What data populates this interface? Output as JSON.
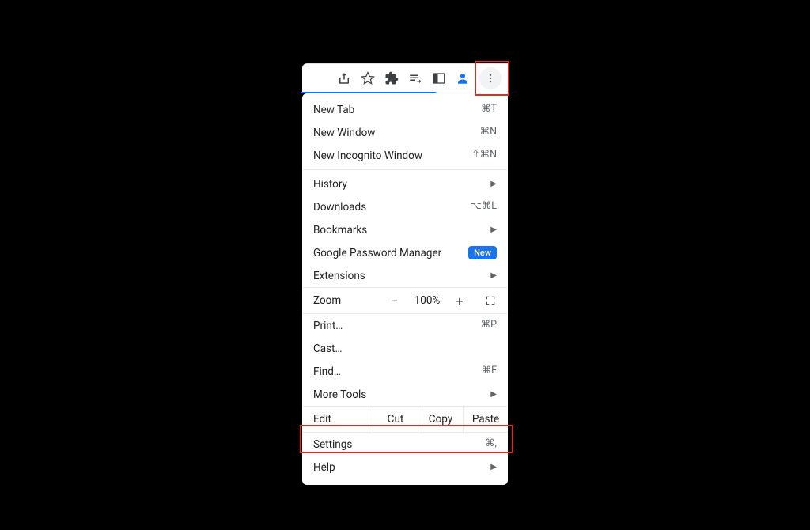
{
  "toolbar_icons": [
    "share",
    "star",
    "puzzle",
    "playlist",
    "panel",
    "profile",
    "kebab"
  ],
  "menu": {
    "group1": [
      {
        "label": "New Tab",
        "shortcut": "⌘T"
      },
      {
        "label": "New Window",
        "shortcut": "⌘N"
      },
      {
        "label": "New Incognito Window",
        "shortcut": "⇧⌘N"
      }
    ],
    "group2": [
      {
        "label": "History",
        "submenu": true
      },
      {
        "label": "Downloads",
        "shortcut": "⌥⌘L"
      },
      {
        "label": "Bookmarks",
        "submenu": true
      },
      {
        "label": "Google Password Manager",
        "badge": "New"
      },
      {
        "label": "Extensions",
        "submenu": true
      }
    ],
    "zoom": {
      "label": "Zoom",
      "value": "100%",
      "minus": "−",
      "plus": "+"
    },
    "group3": [
      {
        "label": "Print…",
        "shortcut": "⌘P"
      },
      {
        "label": "Cast…"
      },
      {
        "label": "Find…",
        "shortcut": "⌘F"
      },
      {
        "label": "More Tools",
        "submenu": true
      }
    ],
    "edit": {
      "label": "Edit",
      "cut": "Cut",
      "copy": "Copy",
      "paste": "Paste"
    },
    "group4": [
      {
        "label": "Settings",
        "shortcut": "⌘,"
      },
      {
        "label": "Help",
        "submenu": true
      }
    ]
  }
}
